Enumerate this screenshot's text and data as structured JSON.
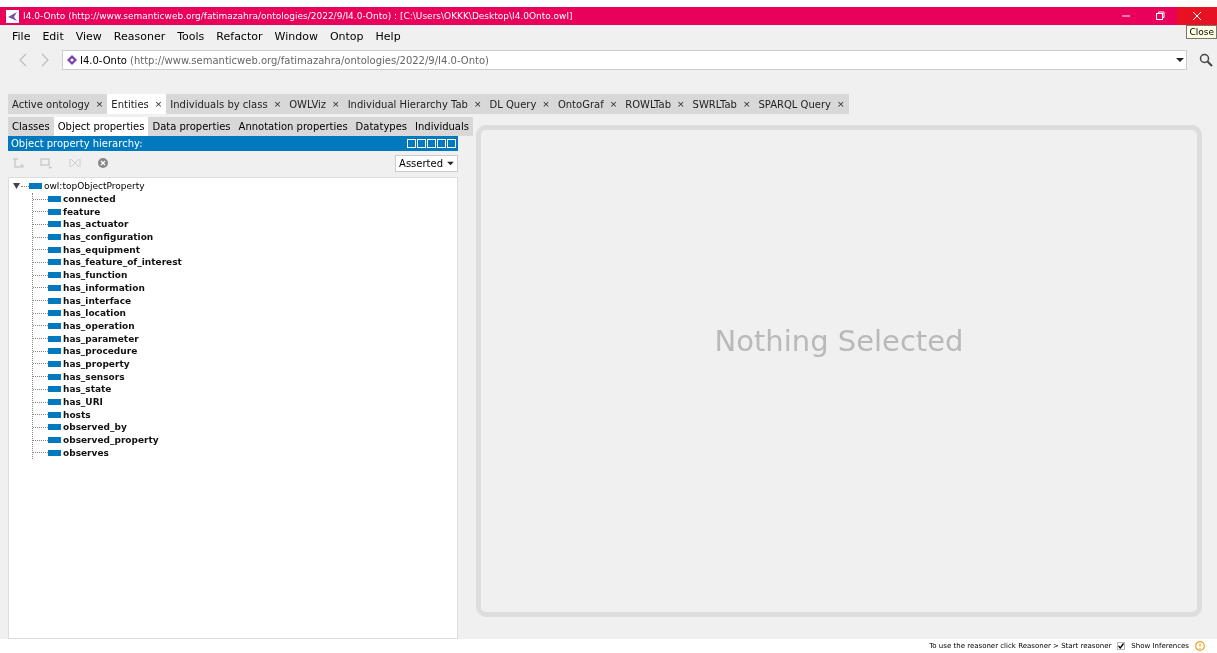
{
  "window": {
    "title": "I4.0-Onto (http://www.semanticweb.org/fatimazahra/ontologies/2022/9/I4.0-Onto)  : [C:\\Users\\OKKK\\Desktop\\I4.0Onto.owl]",
    "tooltip": "Close"
  },
  "menu": [
    "File",
    "Edit",
    "View",
    "Reasoner",
    "Tools",
    "Refactor",
    "Window",
    "Ontop",
    "Help"
  ],
  "address": {
    "name": "I4.0-Onto",
    "iri": "(http://www.semanticweb.org/fatimazahra/ontologies/2022/9/I4.0-Onto)"
  },
  "tabs": [
    {
      "label": "Active ontology",
      "selected": false
    },
    {
      "label": "Entities",
      "selected": true
    },
    {
      "label": "Individuals by class",
      "selected": false
    },
    {
      "label": "OWLViz",
      "selected": false
    },
    {
      "label": "Individual Hierarchy Tab",
      "selected": false
    },
    {
      "label": "DL Query",
      "selected": false
    },
    {
      "label": "OntoGraf",
      "selected": false
    },
    {
      "label": "ROWLTab",
      "selected": false
    },
    {
      "label": "SWRLTab",
      "selected": false
    },
    {
      "label": "SPARQL Query",
      "selected": false
    }
  ],
  "tab_close": "×",
  "entity_tabs": [
    {
      "label": "Classes",
      "selected": false
    },
    {
      "label": "Object properties",
      "selected": true
    },
    {
      "label": "Data properties",
      "selected": false
    },
    {
      "label": "Annotation properties",
      "selected": false
    },
    {
      "label": "Datatypes",
      "selected": false
    },
    {
      "label": "Individuals",
      "selected": false
    }
  ],
  "panel": {
    "title": "Object property hierarchy:",
    "mode": "Asserted"
  },
  "tree": {
    "label": "owl:topObjectProperty",
    "expanded": true,
    "children": [
      {
        "label": "connected"
      },
      {
        "label": "feature"
      },
      {
        "label": "has_actuator"
      },
      {
        "label": "has_configuration"
      },
      {
        "label": "has_equipment"
      },
      {
        "label": "has_feature_of_interest"
      },
      {
        "label": "has_function"
      },
      {
        "label": "has_information"
      },
      {
        "label": "has_interface"
      },
      {
        "label": "has_location"
      },
      {
        "label": "has_operation"
      },
      {
        "label": "has_parameter"
      },
      {
        "label": "has_procedure"
      },
      {
        "label": "has_property"
      },
      {
        "label": "has_sensors"
      },
      {
        "label": "has_state"
      },
      {
        "label": "has_URI"
      },
      {
        "label": "hosts"
      },
      {
        "label": "observed_by"
      },
      {
        "label": "observed_property"
      },
      {
        "label": "observes"
      }
    ]
  },
  "detail": {
    "message": "Nothing Selected"
  },
  "status_bar": {
    "hint": "To use the reasoner click Reasoner > Start reasoner",
    "show_inferences": {
      "label": "Show Inferences",
      "checked": true
    }
  }
}
